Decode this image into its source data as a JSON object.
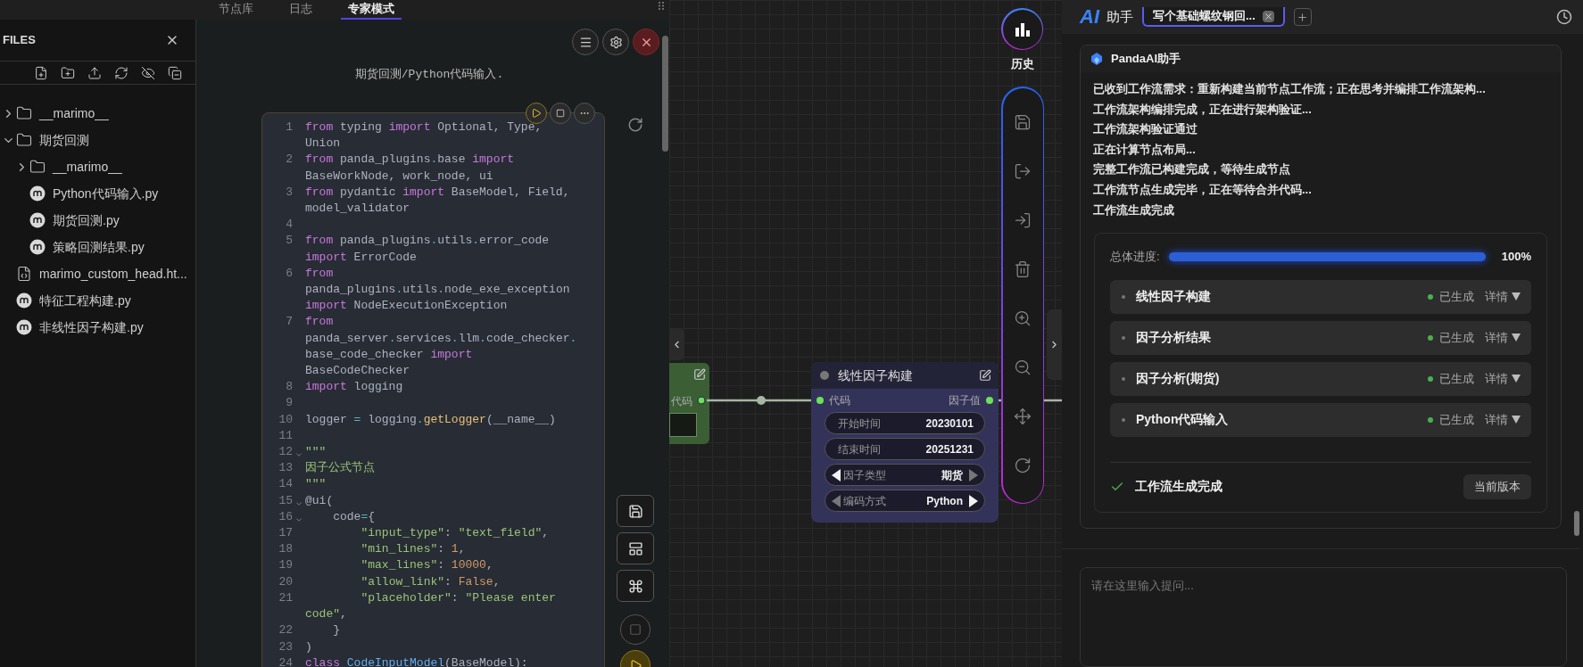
{
  "top_tabs": [
    {
      "label": "节点库",
      "selected": false
    },
    {
      "label": "日志",
      "selected": false
    },
    {
      "label": "专家模式",
      "selected": true
    }
  ],
  "files": {
    "title": "FILES",
    "tree": [
      {
        "name": "__marimo__",
        "kind": "folder",
        "expanded": false
      },
      {
        "name": "期货回测",
        "kind": "folder",
        "expanded": true,
        "children": [
          {
            "name": "__marimo__",
            "kind": "folder",
            "expanded": false
          },
          {
            "name": "Python代码输入.py",
            "kind": "marimo"
          },
          {
            "name": "期货回测.py",
            "kind": "marimo"
          },
          {
            "name": "策略回测结果.py",
            "kind": "marimo"
          }
        ]
      },
      {
        "name": "marimo_custom_head.ht...",
        "kind": "html"
      },
      {
        "name": "特征工程构建.py",
        "kind": "marimo"
      },
      {
        "name": "非线性因子构建.py",
        "kind": "marimo"
      }
    ]
  },
  "editor": {
    "path": "期货回测/Python代码输入.",
    "lines": [
      {
        "number": "1",
        "foldable": false,
        "segments": [
          {
            "kind": "kw",
            "text": "from"
          },
          {
            "kind": "plain",
            "text": " typing "
          },
          {
            "kind": "kw",
            "text": "import"
          },
          {
            "kind": "plain",
            "text": " Optional, Type, Union"
          }
        ]
      },
      {
        "number": "2",
        "foldable": false,
        "segments": [
          {
            "kind": "kw",
            "text": "from"
          },
          {
            "kind": "plain",
            "text": " panda_plugins"
          },
          {
            "kind": "op",
            "text": "."
          },
          {
            "kind": "plain",
            "text": "base "
          },
          {
            "kind": "kw",
            "text": "import"
          },
          {
            "kind": "plain",
            "text": " BaseWorkNode, work_node, ui"
          }
        ]
      },
      {
        "number": "3",
        "foldable": false,
        "segments": [
          {
            "kind": "kw",
            "text": "from"
          },
          {
            "kind": "plain",
            "text": " pydantic "
          },
          {
            "kind": "kw",
            "text": "import"
          },
          {
            "kind": "plain",
            "text": " BaseModel, Field, model_validator"
          }
        ]
      },
      {
        "number": "4",
        "foldable": false
      },
      {
        "number": "5",
        "foldable": false,
        "segments": [
          {
            "kind": "kw",
            "text": "from"
          },
          {
            "kind": "plain",
            "text": " panda_plugins"
          },
          {
            "kind": "op",
            "text": "."
          },
          {
            "kind": "plain",
            "text": "utils"
          },
          {
            "kind": "op",
            "text": "."
          },
          {
            "kind": "plain",
            "text": "error_code "
          },
          {
            "kind": "kw",
            "text": "import"
          },
          {
            "kind": "plain",
            "text": " ErrorCode"
          }
        ]
      },
      {
        "number": "6",
        "foldable": false,
        "segments": [
          {
            "kind": "kw",
            "text": "from"
          },
          {
            "kind": "plain",
            "text": " panda_plugins"
          },
          {
            "kind": "op",
            "text": "."
          },
          {
            "kind": "plain",
            "text": "utils"
          },
          {
            "kind": "op",
            "text": "."
          },
          {
            "kind": "plain",
            "text": "node_exe_exception "
          },
          {
            "kind": "kw",
            "text": "import"
          },
          {
            "kind": "plain",
            "text": " NodeExecutionException"
          }
        ]
      },
      {
        "number": "7",
        "foldable": false,
        "segments": [
          {
            "kind": "kw",
            "text": "from"
          },
          {
            "kind": "plain",
            "text": " panda_server"
          },
          {
            "kind": "op",
            "text": "."
          },
          {
            "kind": "plain",
            "text": "services"
          },
          {
            "kind": "op",
            "text": "."
          },
          {
            "kind": "plain",
            "text": "llm"
          },
          {
            "kind": "op",
            "text": "."
          },
          {
            "kind": "plain",
            "text": "code_checker"
          },
          {
            "kind": "op",
            "text": "."
          },
          {
            "kind": "plain",
            "text": "base_code_checker "
          },
          {
            "kind": "kw",
            "text": "import"
          },
          {
            "kind": "plain",
            "text": " BaseCodeChecker"
          }
        ]
      },
      {
        "number": "8",
        "foldable": false,
        "segments": [
          {
            "kind": "kw",
            "text": "import"
          },
          {
            "kind": "plain",
            "text": " logging"
          }
        ]
      },
      {
        "number": "9",
        "foldable": false
      },
      {
        "number": "10",
        "foldable": false,
        "segments": [
          {
            "kind": "plain",
            "text": "logger "
          },
          {
            "kind": "op",
            "text": "="
          },
          {
            "kind": "plain",
            "text": " logging"
          },
          {
            "kind": "op",
            "text": "."
          },
          {
            "kind": "fn",
            "text": "getLogger"
          },
          {
            "kind": "plain",
            "text": "(__name__)"
          }
        ]
      },
      {
        "number": "11",
        "foldable": false
      },
      {
        "number": "12",
        "foldable": true,
        "segments": [
          {
            "kind": "str",
            "text": "\"\"\""
          }
        ]
      },
      {
        "number": "13",
        "foldable": false,
        "segments": [
          {
            "kind": "str",
            "text": "因子公式节点"
          }
        ]
      },
      {
        "number": "14",
        "foldable": false,
        "segments": [
          {
            "kind": "str",
            "text": "\"\"\""
          }
        ]
      },
      {
        "number": "15",
        "foldable": true,
        "segments": [
          {
            "kind": "plain",
            "text": "@ui("
          }
        ]
      },
      {
        "number": "16",
        "foldable": true,
        "segments": [
          {
            "kind": "plain",
            "text": "    code"
          },
          {
            "kind": "op",
            "text": "="
          },
          {
            "kind": "plain",
            "text": "{"
          }
        ]
      },
      {
        "number": "17",
        "foldable": false,
        "segments": [
          {
            "kind": "str",
            "text": "        \"input_type\""
          },
          {
            "kind": "plain",
            "text": ": "
          },
          {
            "kind": "str",
            "text": "\"text_field\""
          },
          {
            "kind": "plain",
            "text": ","
          }
        ]
      },
      {
        "number": "18",
        "foldable": false,
        "segments": [
          {
            "kind": "str",
            "text": "        \"min_lines\""
          },
          {
            "kind": "plain",
            "text": ": "
          },
          {
            "kind": "num",
            "text": "1"
          },
          {
            "kind": "plain",
            "text": ","
          }
        ]
      },
      {
        "number": "19",
        "foldable": false,
        "segments": [
          {
            "kind": "str",
            "text": "        \"max_lines\""
          },
          {
            "kind": "plain",
            "text": ": "
          },
          {
            "kind": "num",
            "text": "10000"
          },
          {
            "kind": "plain",
            "text": ","
          }
        ]
      },
      {
        "number": "20",
        "foldable": false,
        "segments": [
          {
            "kind": "str",
            "text": "        \"allow_link\""
          },
          {
            "kind": "plain",
            "text": ": "
          },
          {
            "kind": "num",
            "text": "False"
          },
          {
            "kind": "plain",
            "text": ","
          }
        ]
      },
      {
        "number": "21",
        "foldable": false,
        "segments": [
          {
            "kind": "str",
            "text": "        \"placeholder\""
          },
          {
            "kind": "plain",
            "text": ": "
          },
          {
            "kind": "str",
            "text": "\"Please enter code\""
          },
          {
            "kind": "plain",
            "text": ","
          }
        ]
      },
      {
        "number": "22",
        "foldable": false,
        "segments": [
          {
            "kind": "plain",
            "text": "    }"
          }
        ]
      },
      {
        "number": "23",
        "foldable": false,
        "segments": [
          {
            "kind": "plain",
            "text": ")"
          }
        ]
      },
      {
        "number": "24",
        "foldable": false,
        "segments": [
          {
            "kind": "kw",
            "text": "class"
          },
          {
            "kind": "cls",
            "text": " CodeInputModel"
          },
          {
            "kind": "plain",
            "text": "(BaseModel):"
          }
        ]
      }
    ]
  },
  "canvas": {
    "partial_node": {
      "port": "代码"
    },
    "node": {
      "title": "线性因子构建",
      "input": "代码",
      "output": "因子值",
      "fields": [
        {
          "kind": "value",
          "label": "开始时间",
          "value": "20230101"
        },
        {
          "kind": "value",
          "label": "结束时间",
          "value": "20251231"
        },
        {
          "kind": "combo",
          "label": "因子类型",
          "value": "期货",
          "prev_enabled": true,
          "next_enabled": false
        },
        {
          "kind": "combo",
          "label": "编码方式",
          "value": "Python",
          "prev_enabled": false,
          "next_enabled": true
        }
      ]
    },
    "history_label": "历史"
  },
  "assistant": {
    "logo": "AI",
    "title": "助手",
    "tabs": [
      {
        "label": "写个基础螺纹钢回...",
        "selected": true
      }
    ],
    "card": {
      "sender": "PandaAI助手",
      "messages": [
        "已收到工作流需求：重新构建当前节点工作流；正在思考并编排工作流架构...",
        "工作流架构编排完成，正在进行架构验证...",
        "工作流架构验证通过",
        "正在计算节点布局...",
        "完整工作流已构建完成，等待生成节点",
        "工作流节点生成完毕，正在等待合并代码...",
        "工作流生成完成"
      ],
      "progress": {
        "label": "总体进度:",
        "level": 1,
        "reading": "100%"
      },
      "steps": [
        {
          "name": "线性因子构建",
          "status": "已生成",
          "color": "#4caf50",
          "details": "详情"
        },
        {
          "name": "因子分析结果",
          "status": "已生成",
          "color": "#4caf50",
          "details": "详情"
        },
        {
          "name": "因子分析(期货)",
          "status": "已生成",
          "color": "#4caf50",
          "details": "详情"
        },
        {
          "name": "Python代码输入",
          "status": "已生成",
          "color": "#4caf50",
          "details": "详情"
        }
      ],
      "done": "工作流生成完成",
      "version_button": "当前版本"
    },
    "input": {
      "placeholder": "请在这里输入提问..."
    }
  }
}
